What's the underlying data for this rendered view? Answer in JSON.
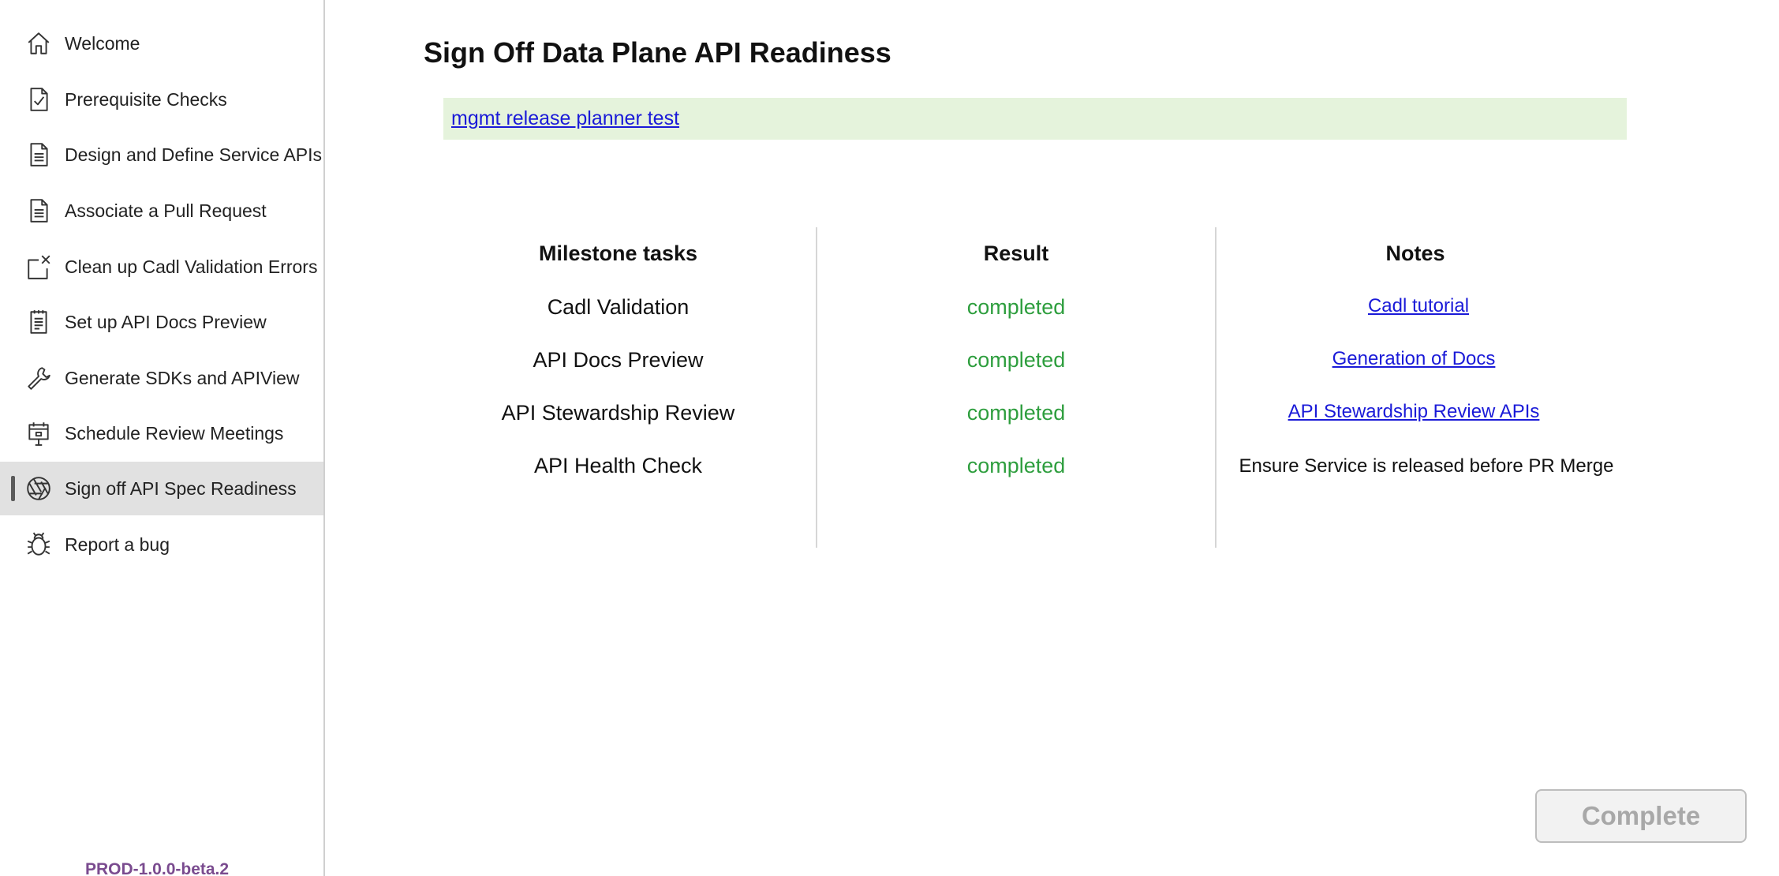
{
  "sidebar": {
    "items": [
      {
        "label": "Welcome",
        "icon": "home-icon"
      },
      {
        "label": "Prerequisite Checks",
        "icon": "checklist-icon"
      },
      {
        "label": "Design and Define Service APIs",
        "icon": "document-icon"
      },
      {
        "label": "Associate a Pull Request",
        "icon": "document-icon"
      },
      {
        "label": "Clean up Cadl Validation Errors",
        "icon": "open-close-icon"
      },
      {
        "label": "Set up API Docs Preview",
        "icon": "notepad-icon"
      },
      {
        "label": "Generate SDKs and APIView",
        "icon": "wrench-icon"
      },
      {
        "label": "Schedule Review Meetings",
        "icon": "calendar-presentation-icon"
      },
      {
        "label": "Sign off API Spec Readiness",
        "icon": "aperture-icon",
        "active": true
      },
      {
        "label": "Report a bug",
        "icon": "bug-icon"
      }
    ],
    "version": "PROD-1.0.0-beta.2"
  },
  "main": {
    "title": "Sign Off Data Plane API Readiness",
    "banner_link": "mgmt release planner test",
    "columns": {
      "tasks": "Milestone tasks",
      "result": "Result",
      "notes": "Notes"
    },
    "rows": [
      {
        "task": "Cadl Validation",
        "result": "completed",
        "note": "Cadl tutorial",
        "note_is_link": true
      },
      {
        "task": "API Docs Preview",
        "result": "completed",
        "note": "Generation of Docs",
        "note_is_link": true
      },
      {
        "task": "API Stewardship Review",
        "result": "completed",
        "note": "API Stewardship Review APIs",
        "note_is_link": true
      },
      {
        "task": "API Health Check",
        "result": "completed",
        "note": "Ensure Service is released before PR Merge",
        "note_is_link": false
      }
    ],
    "complete_label": "Complete"
  },
  "colors": {
    "active_bg": "#e1e1e1",
    "banner_bg": "#e5f3dc",
    "link": "#1a1ad8",
    "success": "#2e9e3e",
    "version": "#7a4b8f"
  }
}
